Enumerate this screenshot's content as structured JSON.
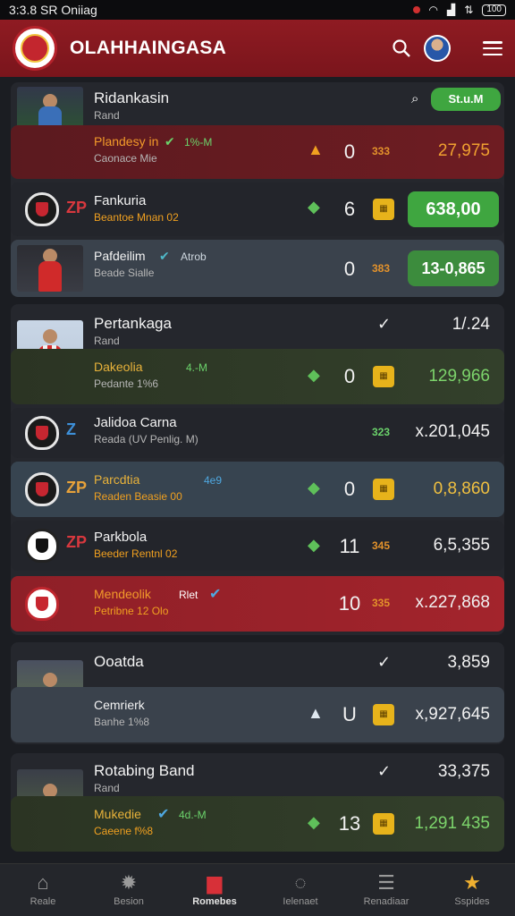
{
  "status_bar": {
    "time": "3:3.8 SR Oniiag",
    "battery": "100"
  },
  "app_bar": {
    "title": "OLAHHAINGASA"
  },
  "groups": [
    {
      "header": {
        "name": "Ridankasin",
        "sub": "Rand",
        "pill": "St.u.M"
      },
      "rows": [
        {
          "name": "Plandesy in",
          "tag": "1%-M",
          "sub": "Caonace Mie",
          "num": "0",
          "code": "333",
          "value": "27,975"
        },
        {
          "name": "Fankuria",
          "sub": "Beantoe Mnan 02",
          "num": "6",
          "value": "638,00"
        },
        {
          "name": "Pafdeilim",
          "tag": "Atrob",
          "sub": "Beade Sialle",
          "num": "0",
          "code": "383",
          "value": "13-0,865"
        }
      ]
    },
    {
      "header": {
        "name": "Pertankaga",
        "sub": "Rand",
        "value": "1/.24"
      },
      "rows": [
        {
          "name": "Dakeolia",
          "tag": "4.-M",
          "sub": "Pedante 1%6",
          "num": "0",
          "value": "129,966"
        },
        {
          "name": "Jalidoa Carna",
          "sub": "Reada (UV Penlig. M)",
          "code": "323",
          "value": "x.201,045"
        },
        {
          "name": "Parcdtia",
          "tag": "4e9",
          "sub": "Readen Beasie 00",
          "num": "0",
          "value": "0,8,860"
        },
        {
          "name": "Parkbola",
          "sub": "Beeder Rentnl 02",
          "num": "11",
          "code": "345",
          "value": "6,5,355"
        },
        {
          "name": "Mendeolik",
          "tag": "Rlet",
          "sub": "Petribne 12 Olo",
          "num": "10",
          "code": "335",
          "value": "x.227,868"
        }
      ]
    },
    {
      "header": {
        "name": "Ooatda",
        "value": "3,859"
      },
      "rows": [
        {
          "name": "Cemrierk",
          "sub": "Banhe 1%8",
          "num": "U",
          "value": "x,927,645"
        }
      ]
    },
    {
      "header": {
        "name": "Rotabing Band",
        "sub": "Rand",
        "value": "33,375"
      },
      "rows": [
        {
          "name": "Mukedie",
          "tag": "4d.-M",
          "sub": "Caeene f%8",
          "num": "13",
          "value": "1,291 435"
        }
      ]
    }
  ],
  "bottom_nav": [
    "Reale",
    "Besion",
    "Romebes",
    "Ielenaet",
    "Renadiaar",
    "Sspides"
  ]
}
